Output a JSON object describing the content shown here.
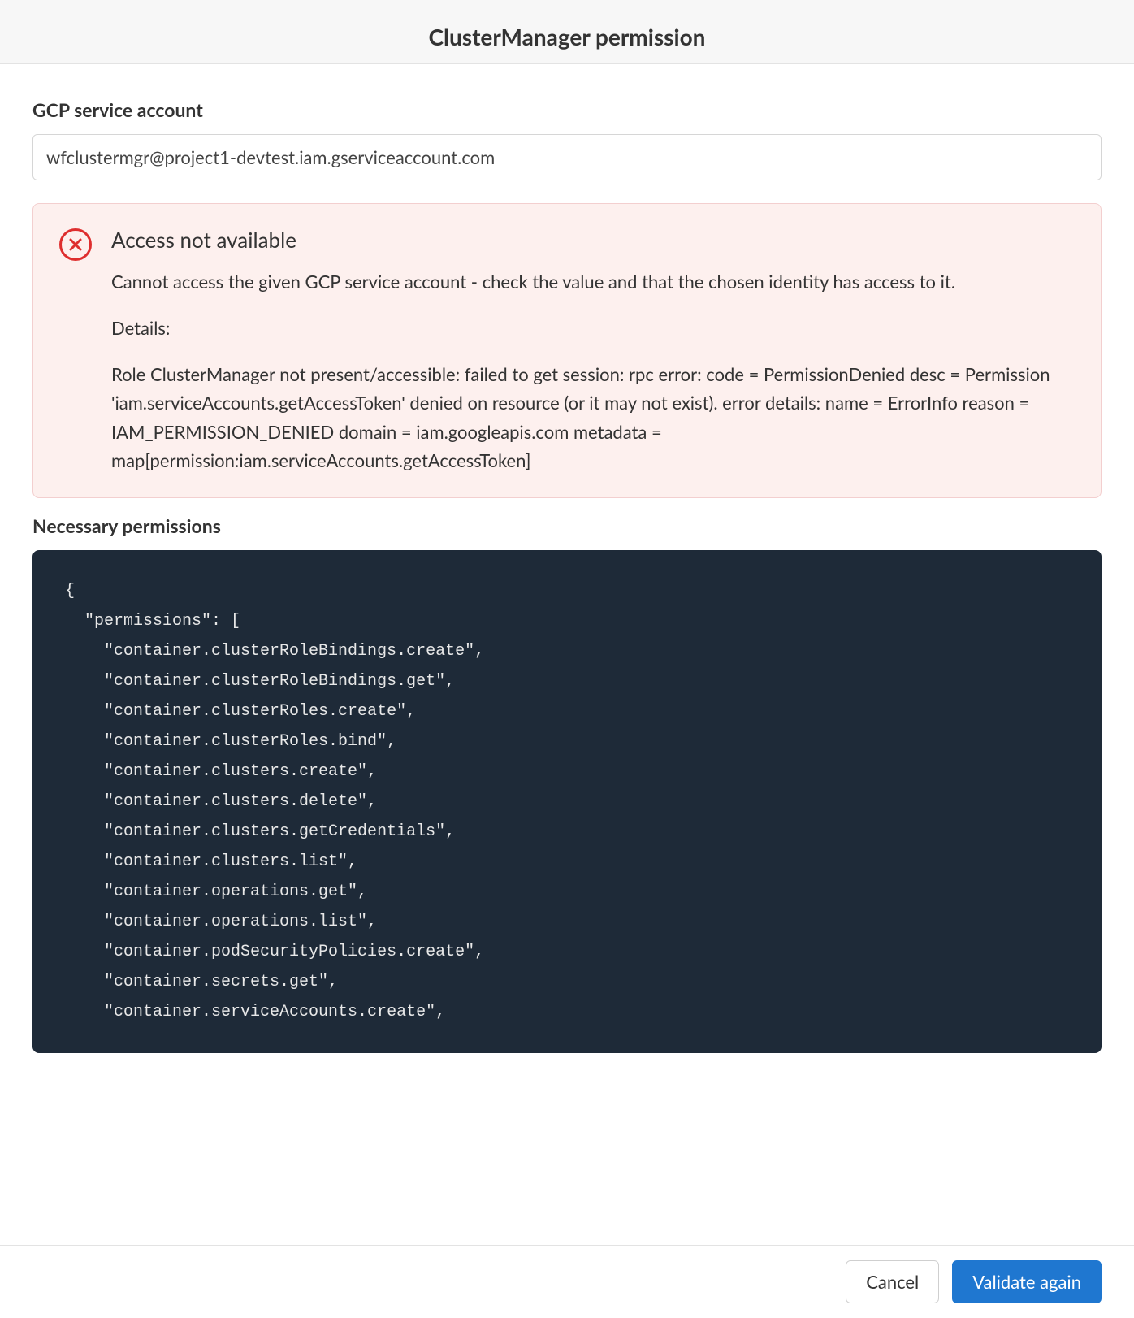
{
  "header": {
    "title": "ClusterManager permission"
  },
  "service_account": {
    "label": "GCP service account",
    "value": "wfclustermgr@project1-devtest.iam.gserviceaccount.com"
  },
  "error": {
    "title": "Access not available",
    "message": "Cannot access the given GCP service account - check the value and that the chosen identity has access to it.",
    "details_label": "Details:",
    "details": "Role ClusterManager not present/accessible: failed to get session: rpc error: code = PermissionDenied desc = Permission 'iam.serviceAccounts.getAccessToken' denied on resource (or it may not exist). error details: name = ErrorInfo reason = IAM_PERMISSION_DENIED domain = iam.googleapis.com metadata = map[permission:iam.serviceAccounts.getAccessToken]"
  },
  "permissions": {
    "label": "Necessary permissions",
    "list": [
      "container.clusterRoleBindings.create",
      "container.clusterRoleBindings.get",
      "container.clusterRoles.create",
      "container.clusterRoles.bind",
      "container.clusters.create",
      "container.clusters.delete",
      "container.clusters.getCredentials",
      "container.clusters.list",
      "container.operations.get",
      "container.operations.list",
      "container.podSecurityPolicies.create",
      "container.secrets.get",
      "container.serviceAccounts.create"
    ]
  },
  "footer": {
    "cancel_label": "Cancel",
    "validate_label": "Validate again"
  }
}
